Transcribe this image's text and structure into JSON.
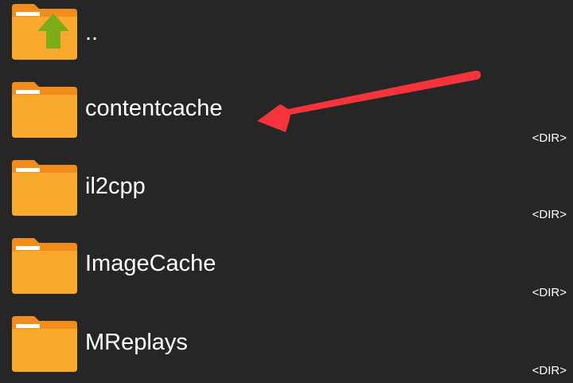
{
  "colors": {
    "background": "#262626",
    "folder_body": "#f9a92b",
    "folder_back": "#f28c1b",
    "folder_paper": "#ffffff",
    "up_arrow": "#7cad19",
    "annotation_arrow": "#f4333a",
    "text": "#ffffff"
  },
  "file_list": {
    "parent": {
      "name": "..",
      "icon": "folder-up-icon"
    },
    "items": [
      {
        "name": "contentcache",
        "type_label": "<DIR>",
        "icon": "folder-icon"
      },
      {
        "name": "il2cpp",
        "type_label": "<DIR>",
        "icon": "folder-icon"
      },
      {
        "name": "ImageCache",
        "type_label": "<DIR>",
        "icon": "folder-icon"
      },
      {
        "name": "MReplays",
        "type_label": "<DIR>",
        "icon": "folder-icon"
      }
    ]
  },
  "annotation": {
    "icon": "red-arrow-icon",
    "points_to": "contentcache"
  }
}
